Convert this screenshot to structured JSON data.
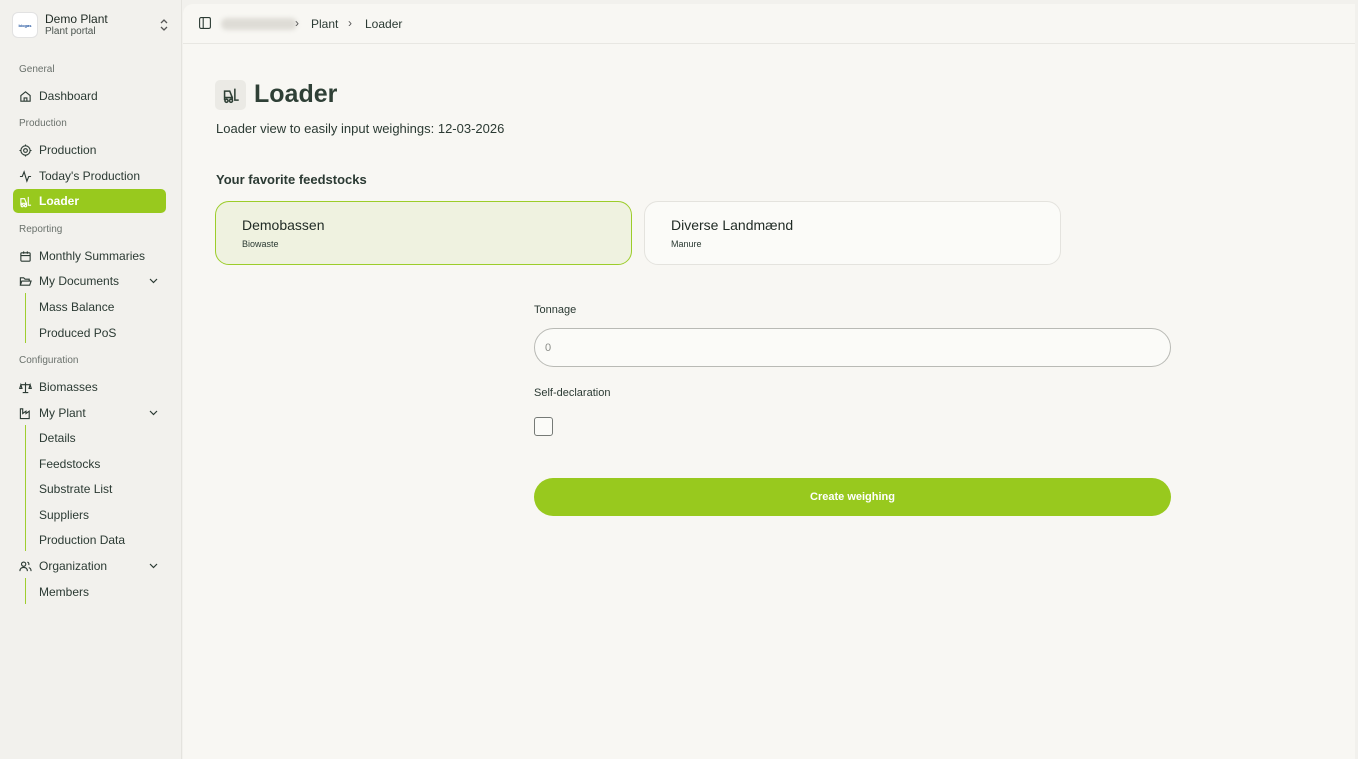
{
  "org": {
    "name": "Demo Plant",
    "subtitle": "Plant portal",
    "logo_text": "biogas"
  },
  "sidebar": {
    "sections": {
      "general": "General",
      "production": "Production",
      "reporting": "Reporting",
      "configuration": "Configuration"
    },
    "items": {
      "dashboard": "Dashboard",
      "production": "Production",
      "todays_production": "Today's Production",
      "loader": "Loader",
      "monthly_summaries": "Monthly Summaries",
      "my_documents": "My Documents",
      "mass_balance": "Mass Balance",
      "produced_pos": "Produced PoS",
      "biomasses": "Biomasses",
      "my_plant": "My Plant",
      "details": "Details",
      "feedstocks": "Feedstocks",
      "substrate_list": "Substrate List",
      "suppliers": "Suppliers",
      "production_data": "Production Data",
      "organization": "Organization",
      "members": "Members"
    },
    "accent_color": "#98c91e"
  },
  "breadcrumb": {
    "items": [
      "Plant",
      "Loader"
    ],
    "separator": "›"
  },
  "page": {
    "title": "Loader",
    "subtitle": "Loader view to easily input weighings: 12-03-2026",
    "favorites_title": "Your favorite feedstocks"
  },
  "feedstocks": [
    {
      "name": "Demobassen",
      "type": "Biowaste",
      "selected": true
    },
    {
      "name": "Diverse Landmænd",
      "type": "Manure",
      "selected": false
    }
  ],
  "form": {
    "tonnage_label": "Tonnage",
    "tonnage_placeholder": "0",
    "self_declaration_label": "Self-declaration",
    "self_declaration_checked": false,
    "submit_label": "Create weighing"
  }
}
